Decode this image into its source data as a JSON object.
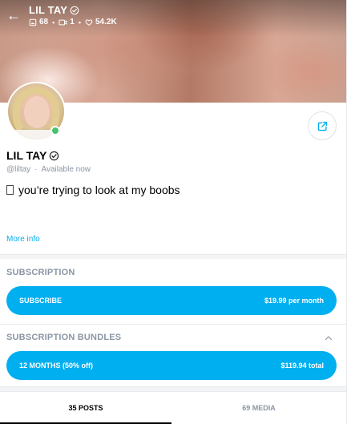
{
  "header": {
    "title": "LIL TAY",
    "stats": {
      "photos": "68",
      "videos": "1",
      "likes": "54.2K"
    }
  },
  "profile": {
    "name": "LIL TAY",
    "handle": "@liltay",
    "status": "Available now",
    "bio": "you’re trying to look at my boobs",
    "more_info": "More info"
  },
  "subscription": {
    "title": "SUBSCRIPTION",
    "button_label": "SUBSCRIBE",
    "price": "$19.99 per month"
  },
  "bundles": {
    "title": "SUBSCRIPTION BUNDLES",
    "label": "12 MONTHS (50% off)",
    "price": "$119.94 total"
  },
  "tabs": [
    {
      "label": "35 POSTS"
    },
    {
      "label": "69 MEDIA"
    }
  ],
  "colors": {
    "accent": "#00aff0",
    "muted": "#8a96a3",
    "online": "#45c36d"
  }
}
